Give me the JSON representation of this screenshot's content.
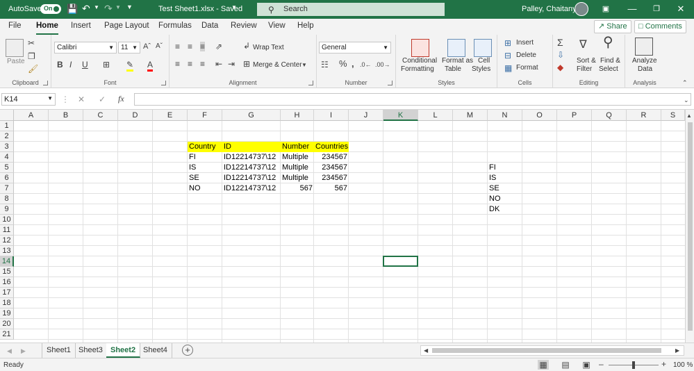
{
  "titlebar": {
    "autosave_label": "AutoSave",
    "autosave_state": "On",
    "file_title": "Test Sheet1.xlsx  -  Saved",
    "search_placeholder": "Search",
    "user_name": "Palley, Chaitanya"
  },
  "menu": {
    "tabs": [
      "File",
      "Home",
      "Insert",
      "Page Layout",
      "Formulas",
      "Data",
      "Review",
      "View",
      "Help"
    ],
    "active": "Home",
    "share_label": "Share",
    "comments_label": "Comments"
  },
  "ribbon": {
    "clipboard": {
      "label": "Clipboard",
      "paste": "Paste"
    },
    "font": {
      "label": "Font",
      "name": "Calibri",
      "size": "11",
      "bold": "B",
      "italic": "I",
      "underline": "U"
    },
    "alignment": {
      "label": "Alignment",
      "wrap": "Wrap Text",
      "merge": "Merge & Center"
    },
    "number": {
      "label": "Number",
      "format": "General"
    },
    "styles": {
      "label": "Styles",
      "conditional_1": "Conditional",
      "conditional_2": "Formatting",
      "table_1": "Format as",
      "table_2": "Table",
      "cell_1": "Cell",
      "cell_2": "Styles"
    },
    "cells": {
      "label": "Cells",
      "insert": "Insert",
      "delete": "Delete",
      "format": "Format"
    },
    "editing": {
      "label": "Editing",
      "sort_1": "Sort &",
      "sort_2": "Filter",
      "find_1": "Find &",
      "find_2": "Select"
    },
    "analysis": {
      "label": "Analysis",
      "analyze_1": "Analyze",
      "analyze_2": "Data"
    }
  },
  "formula_bar": {
    "name_box": "K14",
    "formula": ""
  },
  "grid": {
    "columns": [
      "A",
      "B",
      "C",
      "D",
      "E",
      "F",
      "G",
      "H",
      "I",
      "J",
      "K",
      "L",
      "M",
      "N",
      "O",
      "P",
      "Q",
      "R",
      "S"
    ],
    "rows": [
      "1",
      "2",
      "3",
      "4",
      "5",
      "6",
      "7",
      "8",
      "9",
      "10",
      "11",
      "12",
      "13",
      "14",
      "15",
      "16",
      "17",
      "18",
      "19",
      "20",
      "21"
    ],
    "selected_column": "K",
    "selected_row": "14",
    "cells": {
      "F3": "Country",
      "G3": "ID",
      "H3": "Number",
      "I3": "Countries",
      "F4": "FI",
      "G4": "ID12214737\\12",
      "H4": "Multiple",
      "I4": "234567",
      "F5": "IS",
      "G5": "ID12214737\\12",
      "H5": "Multiple",
      "I5": "234567",
      "F6": "SE",
      "G6": "ID12214737\\12",
      "H6": "Multiple",
      "I6": "234567",
      "F7": "NO",
      "G7": "ID12214737\\12",
      "H7": "567",
      "I7": "567",
      "N5": "FI",
      "N6": "IS",
      "N7": "SE",
      "N8": "NO",
      "N9": "DK"
    },
    "highlight_color": "#ffff00"
  },
  "sheets": {
    "tabs": [
      "Sheet1",
      "Sheet3",
      "Sheet2",
      "Sheet4"
    ],
    "active": "Sheet2"
  },
  "status": {
    "ready": "Ready",
    "zoom": "100 %"
  },
  "colors": {
    "brand": "#217346"
  }
}
